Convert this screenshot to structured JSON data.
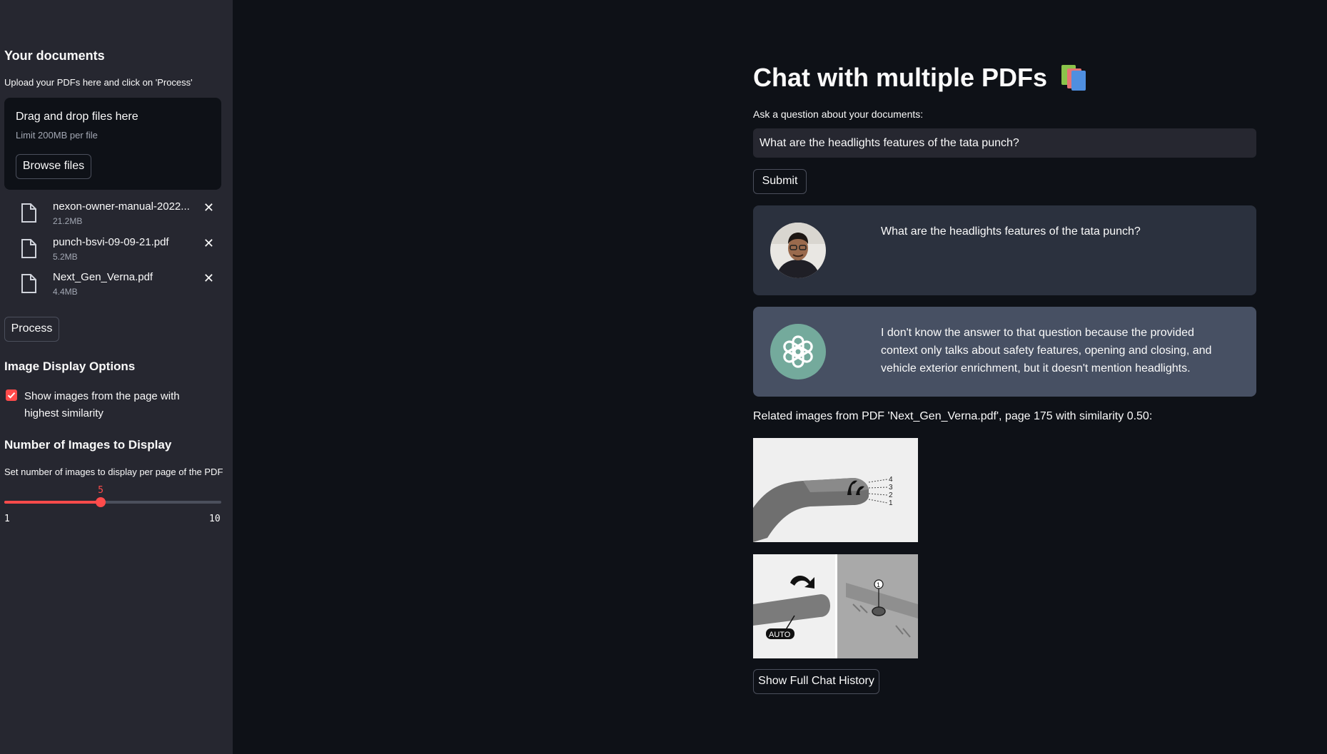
{
  "sidebar": {
    "title": "Your documents",
    "upload_hint": "Upload your PDFs here and click on 'Process'",
    "dropzone": {
      "title": "Drag and drop files here",
      "limit": "Limit 200MB per file",
      "browse_label": "Browse files"
    },
    "files": [
      {
        "name": "nexon-owner-manual-2022...",
        "size": "21.2MB"
      },
      {
        "name": "punch-bsvi-09-09-21.pdf",
        "size": "5.2MB"
      },
      {
        "name": "Next_Gen_Verna.pdf",
        "size": "4.4MB"
      }
    ],
    "process_label": "Process",
    "image_options_title": "Image Display Options",
    "show_images_label": "Show images from the page with highest similarity",
    "show_images_checked": true,
    "num_images_title": "Number of Images to Display",
    "num_images_hint": "Set number of images to display per page of the PDF",
    "slider": {
      "value": "5",
      "min": "1",
      "max": "10"
    }
  },
  "main": {
    "title": "Chat with multiple PDFs",
    "title_icon": "books-icon",
    "ask_label": "Ask a question about your documents:",
    "question_value": "What are the headlights features of the tata punch?",
    "submit_label": "Submit",
    "messages": [
      {
        "role": "user",
        "avatar": "user-photo-avatar",
        "text": "What are the headlights features of the tata punch?"
      },
      {
        "role": "bot",
        "avatar": "openai-logo-avatar",
        "text": "I don't know the answer to that question because the provided context only talks about safety features, opening and closing, and vehicle exterior enrichment, but it doesn't mention headlights."
      }
    ],
    "related_text": "Related images from PDF 'Next_Gen_Verna.pdf', page 175 with similarity 0.50:",
    "images": [
      {
        "labels": [
          "4",
          "3",
          "2",
          "1"
        ]
      },
      {
        "labels": [
          "AUTO",
          "1"
        ]
      }
    ],
    "history_label": "Show Full Chat History"
  },
  "colors": {
    "accent": "#ff4b4b",
    "background": "#0e1117",
    "sidebar": "#262730",
    "user_msg": "#2b313e",
    "bot_msg": "#475063",
    "openai_green": "#74aa9c"
  }
}
